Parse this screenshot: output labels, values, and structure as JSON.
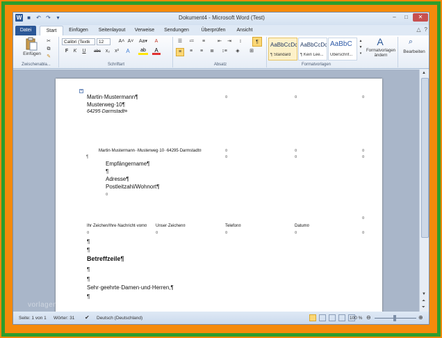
{
  "window": {
    "title": "Dokument4 - Microsoft Word (Test)",
    "controls": {
      "minimize": "–",
      "maximize": "□",
      "close": "✕"
    }
  },
  "quick_access": {
    "icons": [
      "word-logo",
      "save-icon",
      "undo-icon",
      "redo-icon",
      "customize-icon"
    ],
    "logo": "W",
    "save": "■",
    "undo": "↶",
    "redo": "↷",
    "customize": "▾"
  },
  "tabs": [
    {
      "label": "Datei"
    },
    {
      "label": "Start"
    },
    {
      "label": "Einfügen"
    },
    {
      "label": "Seitenlayout"
    },
    {
      "label": "Verweise"
    },
    {
      "label": "Sendungen"
    },
    {
      "label": "Überprüfen"
    },
    {
      "label": "Ansicht"
    }
  ],
  "ribbon_right": {
    "minimize": "△",
    "help": "?"
  },
  "ribbon": {
    "clipboard": {
      "paste": "Einfügen",
      "label": "Zwischenabla..."
    },
    "font": {
      "name": "Calibri (Textk",
      "size": "12",
      "label": "Schriftart",
      "bold": "F",
      "italic": "K",
      "underline": "U",
      "strike": "abc",
      "sub": "x₂",
      "sup": "x²",
      "grow": "A˄",
      "shrink": "A˅",
      "case": "Aa▾",
      "clear": "A"
    },
    "paragraph": {
      "label": "Absatz",
      "pilcrow": "¶"
    },
    "styles": {
      "label": "Formatvorlagen",
      "items": [
        {
          "preview": "AaBbCcDc",
          "name": "¶ Standard"
        },
        {
          "preview": "AaBbCcDc",
          "name": "¶ Kein Lee..."
        },
        {
          "preview": "AaBbC",
          "name": "Überschrif..."
        }
      ],
      "change": "Formatvorlagen ändern",
      "edit": "Bearbeiten"
    }
  },
  "document": {
    "sender": {
      "line1": "Martin·Mustermann¶",
      "line2": "Musterweg·10¶",
      "line3": "64295·Darmstadt¤"
    },
    "return_address": "Martin·Mustermann··Musterweg·10··64295·Darmstadt¤",
    "recipient": {
      "line1": "Empfängername¶",
      "line2": "¶",
      "line3": "Adresse¶",
      "line4": "Postleitzahl/Wohnort¶",
      "line5": "¤"
    },
    "ref_labels": {
      "a": "Ihr·Zeichen/Ihre·Nachricht·vom¤",
      "b": "Unser·Zeichen¤",
      "c": "Telefon¤",
      "d": "Datum¤"
    },
    "subject": "Betreffzeile¶",
    "salutation": "Sehr·geehrte·Damen·und·Herren,¶",
    "pilcrow": "¶",
    "cellmark": "¤",
    "anchor": "+"
  },
  "status": {
    "page": "Seite: 1 von 1",
    "words": "Wörter: 31",
    "language": "Deutsch (Deutschland)",
    "zoom": "100 %"
  },
  "watermark": "vorlagen"
}
